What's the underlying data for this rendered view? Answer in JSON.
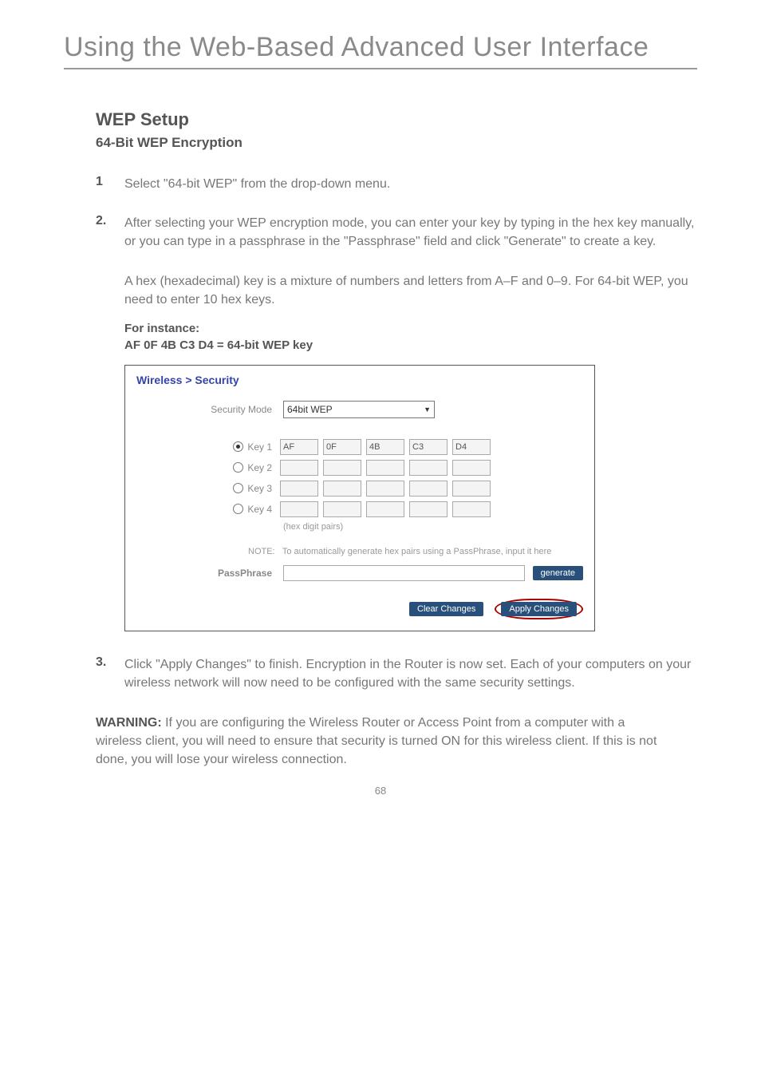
{
  "header": {
    "title": "Using the Web-Based Advanced User Interface"
  },
  "section": {
    "title": "WEP Setup",
    "subtitle": "64-Bit WEP Encryption"
  },
  "steps": {
    "s1": {
      "num": "1",
      "text": "Select \"64-bit WEP\" from the drop-down menu."
    },
    "s2": {
      "num": "2.",
      "text": "After selecting your WEP encryption mode, you can enter your key by typing in the hex key manually, or you can type in a passphrase in the \"Passphrase\" field and click \"Generate\" to create a key.",
      "sub": "A hex (hexadecimal) key is a mixture of numbers and letters from A–F and 0–9. For 64-bit WEP, you need to enter 10 hex keys.",
      "for_instance_label": "For instance:",
      "for_instance_value": "AF 0F 4B C3 D4 = 64-bit WEP key"
    },
    "s3": {
      "num": "3.",
      "text": "Click \"Apply Changes\" to finish. Encryption in the Router is now set. Each of your computers on your wireless network will now need to be configured with the same security settings."
    }
  },
  "screenshot": {
    "breadcrumb": "Wireless > Security",
    "security_mode_label": "Security Mode",
    "security_mode_value": "64bit WEP",
    "keys": {
      "k1": {
        "label": "Key 1",
        "values": [
          "AF",
          "0F",
          "4B",
          "C3",
          "D4"
        ]
      },
      "k2": {
        "label": "Key 2",
        "values": [
          "",
          "",
          "",
          "",
          ""
        ]
      },
      "k3": {
        "label": "Key 3",
        "values": [
          "",
          "",
          "",
          "",
          ""
        ]
      },
      "k4": {
        "label": "Key 4",
        "values": [
          "",
          "",
          "",
          "",
          ""
        ]
      }
    },
    "hex_note": "(hex digit pairs)",
    "note_lead": "NOTE:",
    "note_text": "To automatically generate hex pairs using a PassPhrase, input it here",
    "passphrase_label": "PassPhrase",
    "generate_btn": "generate",
    "clear_btn": "Clear Changes",
    "apply_btn": "Apply Changes"
  },
  "warning": {
    "lead": "WARNING:",
    "text": " If you are configuring the Wireless Router or Access Point from a computer with a wireless client, you will need to ensure that security is turned ON for this wireless client. If this is not done, you will lose your wireless connection."
  },
  "page_number": "68"
}
